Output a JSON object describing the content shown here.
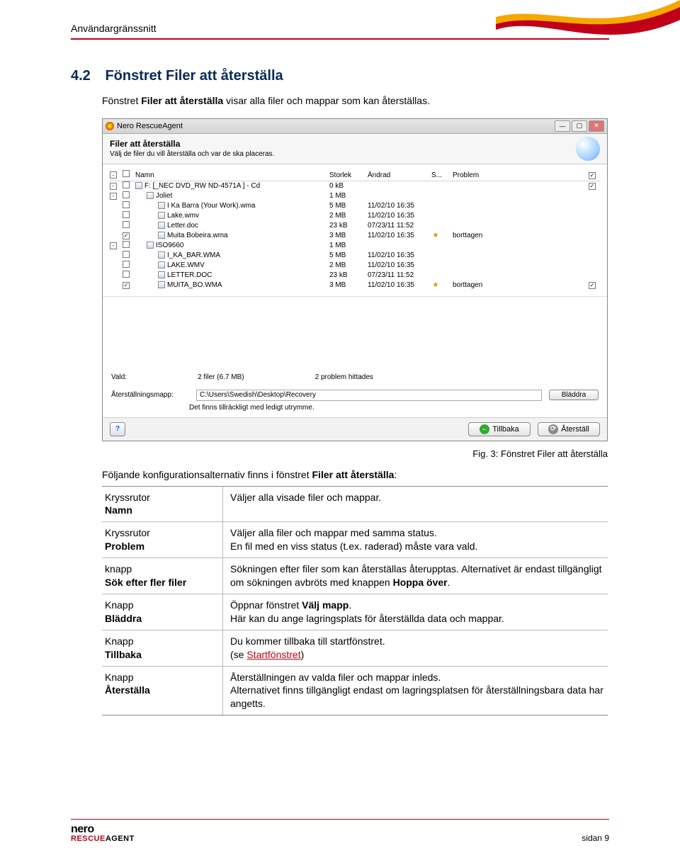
{
  "header": {
    "text": "Användargränssnitt"
  },
  "section": {
    "number": "4.2",
    "title": "Fönstret Filer att återställa",
    "intro_pre": "Fönstret ",
    "intro_bold": "Filer att återställa",
    "intro_post": " visar alla filer och mappar som kan återställas."
  },
  "screenshot": {
    "app_title": "Nero RescueAgent",
    "banner_title": "Filer att återställa",
    "banner_sub": "Välj de filer du vill återställa och var de ska placeras.",
    "columns": {
      "name": "Namn",
      "size": "Storlek",
      "modified": "Ändrad",
      "s": "S...",
      "problem": "Problem"
    },
    "rows": [
      {
        "indent": 0,
        "toggle": "-",
        "checkbox": "empty",
        "icon": "disc",
        "name": "F: [_NEC   DVD_RW ND-4571A ] - Cd",
        "size": "0 kB",
        "modified": "",
        "star": false,
        "problem": "",
        "endcheck": "checked"
      },
      {
        "indent": 1,
        "toggle": "-",
        "checkbox": "empty",
        "icon": "folder",
        "name": "Joliet",
        "size": "1 MB",
        "modified": "",
        "star": false,
        "problem": "",
        "endcheck": ""
      },
      {
        "indent": 2,
        "toggle": "",
        "checkbox": "empty",
        "icon": "file",
        "name": "I Ka Barra (Your Work).wma",
        "size": "5 MB",
        "modified": "11/02/10 16:35",
        "star": false,
        "problem": "",
        "endcheck": ""
      },
      {
        "indent": 2,
        "toggle": "",
        "checkbox": "empty",
        "icon": "file",
        "name": "Lake.wmv",
        "size": "2 MB",
        "modified": "11/02/10 16:35",
        "star": false,
        "problem": "",
        "endcheck": ""
      },
      {
        "indent": 2,
        "toggle": "",
        "checkbox": "empty",
        "icon": "file",
        "name": "Letter.doc",
        "size": "23 kB",
        "modified": "07/23/11 11:52",
        "star": false,
        "problem": "",
        "endcheck": ""
      },
      {
        "indent": 2,
        "toggle": "",
        "checkbox": "checked",
        "icon": "file",
        "name": "Muita Bobeira.wma",
        "size": "3 MB",
        "modified": "11/02/10 16:35",
        "star": true,
        "problem": "borttagen",
        "endcheck": ""
      },
      {
        "indent": 1,
        "toggle": "-",
        "checkbox": "empty",
        "icon": "folder",
        "name": "ISO9660",
        "size": "1 MB",
        "modified": "",
        "star": false,
        "problem": "",
        "endcheck": ""
      },
      {
        "indent": 2,
        "toggle": "",
        "checkbox": "empty",
        "icon": "file",
        "name": "I_KA_BAR.WMA",
        "size": "5 MB",
        "modified": "11/02/10 16:35",
        "star": false,
        "problem": "",
        "endcheck": ""
      },
      {
        "indent": 2,
        "toggle": "",
        "checkbox": "empty",
        "icon": "file",
        "name": "LAKE.WMV",
        "size": "2 MB",
        "modified": "11/02/10 16:35",
        "star": false,
        "problem": "",
        "endcheck": ""
      },
      {
        "indent": 2,
        "toggle": "",
        "checkbox": "empty",
        "icon": "file",
        "name": "LETTER.DOC",
        "size": "23 kB",
        "modified": "07/23/11 11:52",
        "star": false,
        "problem": "",
        "endcheck": ""
      },
      {
        "indent": 2,
        "toggle": "",
        "checkbox": "checked",
        "icon": "file",
        "name": "MUITA_BO.WMA",
        "size": "3 MB",
        "modified": "11/02/10 16:35",
        "star": true,
        "problem": "borttagen",
        "endcheck": "checked"
      }
    ],
    "summary": {
      "selected_label": "Vald:",
      "selected_value": "2 filer (6.7 MB)",
      "problems": "2 problem hittades"
    },
    "path_label": "Återställningsmapp:",
    "path_value": "C:\\Users\\Swedish\\Desktop\\Recovery",
    "browse": "Bläddra",
    "space_note": "Det finns tillräckligt med ledigt utrymme.",
    "back": "Tillbaka",
    "restore": "Återställ"
  },
  "caption": "Fig. 3: Fönstret Filer att återställa",
  "config_intro_pre": "Följande konfigurationsalternativ finns i fönstret ",
  "config_intro_bold": "Filer att återställa",
  "config_intro_post": ":",
  "config": [
    {
      "l1": "Kryssrutor",
      "l2": "Namn",
      "r": "Väljer alla visade filer och mappar."
    },
    {
      "l1": "Kryssrutor",
      "l2": "Problem",
      "r": "Väljer alla filer och mappar med samma status.\nEn fil med en viss status (t.ex. raderad) måste vara vald."
    },
    {
      "l1": "knapp",
      "l2": "Sök efter fler filer",
      "r": "Sökningen efter filer som kan återställas återupptas. Alternativet är endast tillgängligt om sökningen avbröts med knappen ",
      "rb": "Hoppa över",
      "rpost": "."
    },
    {
      "l1": "Knapp",
      "l2": "Bläddra",
      "r": "Öppnar fönstret ",
      "rb": "Välj mapp",
      "rpost": ".\nHär kan du ange lagringsplats för återställda data och mappar."
    },
    {
      "l1": "Knapp",
      "l2": "Tillbaka",
      "r": "Du kommer tillbaka till startfönstret.\n(se ",
      "rlink": "Startfönstret",
      "rpost2": ")"
    },
    {
      "l1": "Knapp",
      "l2": "Återställa",
      "r": "Återställningen av valda filer och mappar inleds.\nAlternativet finns tillgängligt endast om lagringsplatsen för återställningsbara data har angetts."
    }
  ],
  "footer": {
    "logo_top": "nero",
    "logo_bottom_red": "RESCUE",
    "logo_bottom_black": "AGENT",
    "page": "sidan 9"
  }
}
